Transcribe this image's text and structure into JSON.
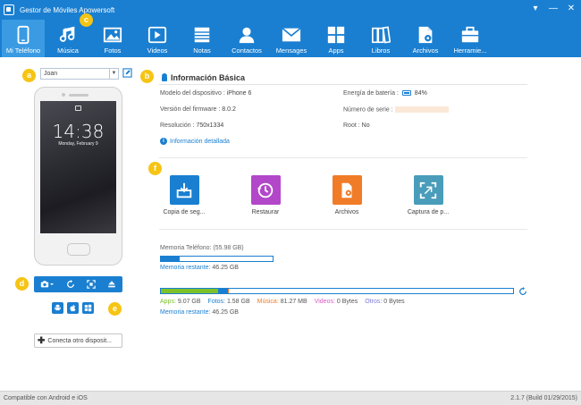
{
  "app": {
    "title": "Gestor de Móviles Apowersoft"
  },
  "window": {
    "menu_icon": "menu-dropdown-icon",
    "minimize": "minimize-icon",
    "close": "close-icon"
  },
  "toolbar": {
    "items": [
      {
        "label": "Mi Teléfono",
        "icon": "phone-icon",
        "active": true
      },
      {
        "label": "Música",
        "icon": "music-icon"
      },
      {
        "label": "Fotos",
        "icon": "photo-icon"
      },
      {
        "label": "Videos",
        "icon": "video-icon"
      },
      {
        "label": "Notas",
        "icon": "notes-icon"
      },
      {
        "label": "Contactos",
        "icon": "contact-icon"
      },
      {
        "label": "Mensages",
        "icon": "message-icon"
      },
      {
        "label": "Apps",
        "icon": "apps-icon"
      },
      {
        "label": "Libros",
        "icon": "books-icon"
      },
      {
        "label": "Archivos",
        "icon": "files-icon"
      },
      {
        "label": "Herramie...",
        "icon": "toolbox-icon"
      }
    ]
  },
  "badges": {
    "a": "a",
    "b": "b",
    "c": "c",
    "d": "d",
    "e": "e",
    "f": "f"
  },
  "device": {
    "selected": "Joan",
    "lock_time": "14:38",
    "lock_date": "Monday, February 9"
  },
  "connect_button": "Conecta otro disposit...",
  "info": {
    "title": "Información Básica",
    "model_label": "Modelo del dispositivo :",
    "model_value": "iPhone 6",
    "firmware_label": "Versión del firmware :",
    "firmware_value": "8.0.2",
    "resolution_label": "Resolución :",
    "resolution_value": "750x1334",
    "battery_label": "Energía de batería :",
    "battery_value": "84%",
    "battery_level": 0.84,
    "serial_label": "Número de serie :",
    "root_label": "Root :",
    "root_value": "No",
    "detail_link": "Información detallada"
  },
  "actions": [
    {
      "label": "Copia de seg...",
      "icon": "backup-icon",
      "color": "#1a7fd1"
    },
    {
      "label": "Restaurar",
      "icon": "restore-icon",
      "color": "#b247c9"
    },
    {
      "label": "Archivos",
      "icon": "files-icon",
      "color": "#f07c28"
    },
    {
      "label": "Captura de p...",
      "icon": "screenshot-icon",
      "color": "#4a9dba"
    }
  ],
  "memory": {
    "phone_label": "Memoria Teléfono: (55.98 GB)",
    "phone_used_fraction": 0.17,
    "rest_label": "Memoria restante:",
    "rest_value": "46.25 GB",
    "breakdown": [
      {
        "label": "Apps:",
        "value": "9.07 GB",
        "color": "#7dc22b",
        "fraction": 0.162
      },
      {
        "label": "Fotos:",
        "value": "1.58 GB",
        "color": "#1a7fd1",
        "fraction": 0.028
      },
      {
        "label": "Música:",
        "value": "81.27 MB",
        "color": "#f07c28",
        "fraction": 0.004
      },
      {
        "label": "Videos:",
        "value": "0 Bytes",
        "color": "#d85cc8",
        "fraction": 0
      },
      {
        "label": "Otros:",
        "value": "0 Bytes",
        "color": "#7b7bd6",
        "fraction": 0
      }
    ],
    "rest2_label": "Memoria restante:",
    "rest2_value": "46.25 GB"
  },
  "status": {
    "left": "Compatible con Android e iOS",
    "right": "2.1.7 (Build 01/29/2015)"
  }
}
